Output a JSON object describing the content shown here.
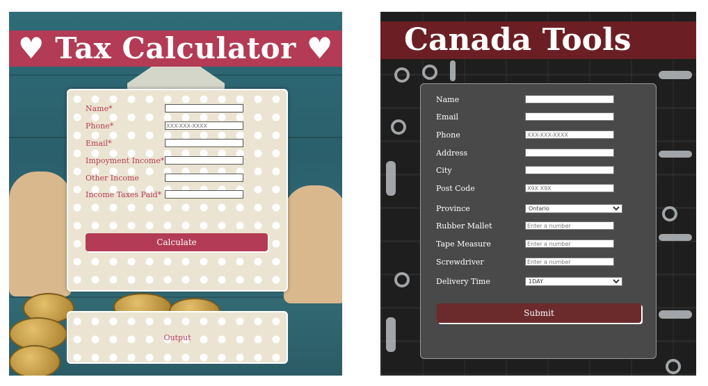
{
  "tax": {
    "title": "♥ Tax Calculator ♥",
    "fields": [
      {
        "label": "Name*",
        "placeholder": ""
      },
      {
        "label": "Phone*",
        "placeholder": "XXX-XXX-XXXX"
      },
      {
        "label": "Email*",
        "placeholder": ""
      },
      {
        "label": "Impoyment Income*",
        "placeholder": ""
      },
      {
        "label": "Other Income",
        "placeholder": ""
      },
      {
        "label": "Income Taxes Paid*",
        "placeholder": ""
      }
    ],
    "calculate_label": "Calculate",
    "output_label": "Output",
    "accent": "#b33b55"
  },
  "canada": {
    "title": "Canada Tools",
    "fields": [
      {
        "label": "Name",
        "placeholder": ""
      },
      {
        "label": "Email",
        "placeholder": ""
      },
      {
        "label": "Phone",
        "placeholder": "XXX-XXX-XXXX"
      },
      {
        "label": "Address",
        "placeholder": ""
      },
      {
        "label": "City",
        "placeholder": ""
      },
      {
        "label": "Post Code",
        "placeholder": "X9X X9X"
      },
      {
        "label": "Province",
        "selected": "Ontario"
      },
      {
        "label": "Rubber Mallet",
        "placeholder": "Enter a number"
      },
      {
        "label": "Tape Measure",
        "placeholder": "Enter a number"
      },
      {
        "label": "Screwdriver",
        "placeholder": "Enter a number"
      },
      {
        "label": "Delivery Time",
        "selected": "1DAY"
      }
    ],
    "submit_label": "Submit",
    "accent": "#6b1f24"
  }
}
